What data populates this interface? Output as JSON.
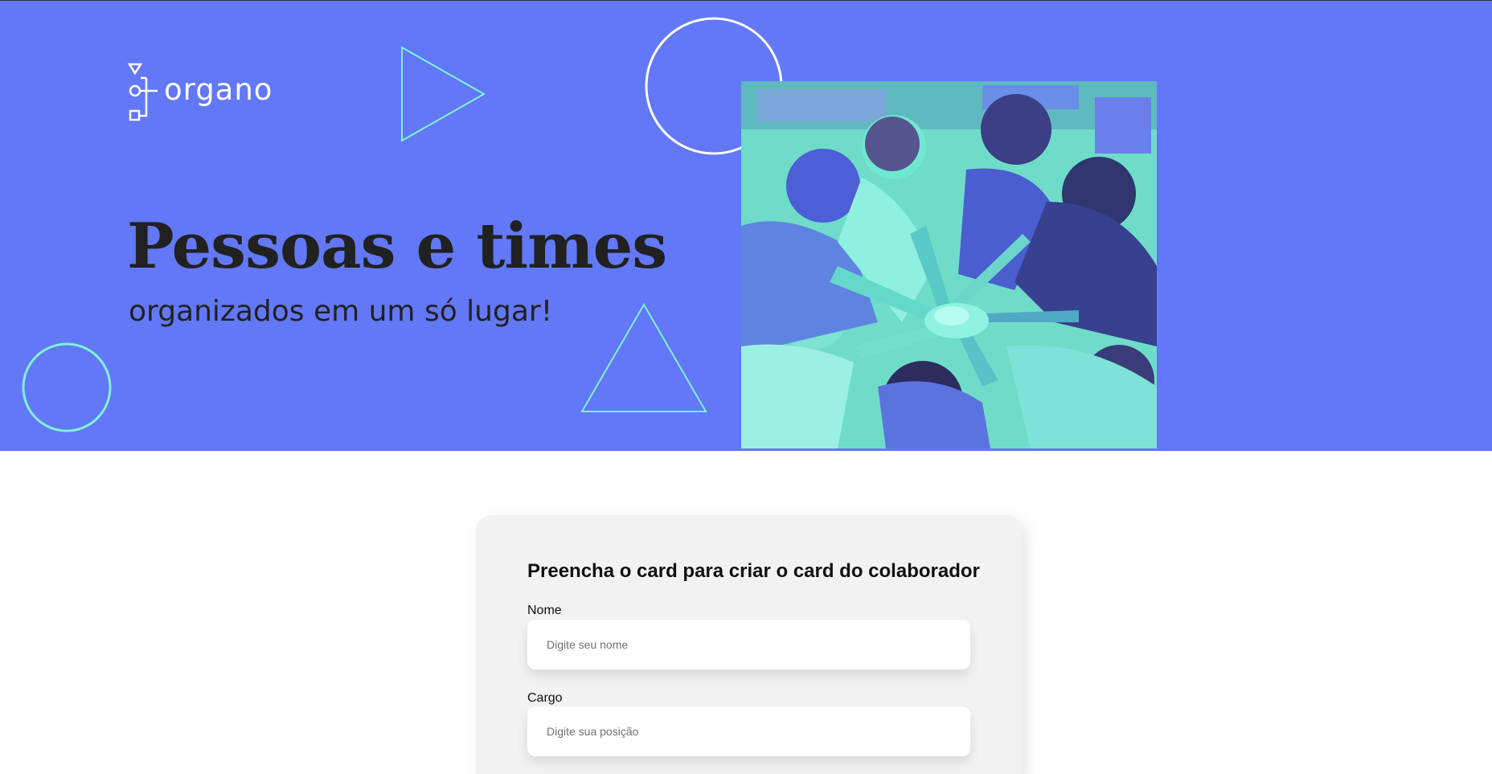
{
  "brand": {
    "logo_text": "organo",
    "colors": {
      "banner": "#6278f7",
      "accent": "#7ef2d6",
      "heading": "#212121",
      "card": "#f2f2f2"
    }
  },
  "hero": {
    "headline": "Pessoas e times",
    "subheadline": "organizados em um só lugar!",
    "image": "team-hands-together-photo"
  },
  "form": {
    "title": "Preencha o card para criar o card do colaborador",
    "fields": [
      {
        "label": "Nome",
        "placeholder": "Digite seu nome",
        "value": ""
      },
      {
        "label": "Cargo",
        "placeholder": "Digite sua posição",
        "value": ""
      }
    ]
  }
}
